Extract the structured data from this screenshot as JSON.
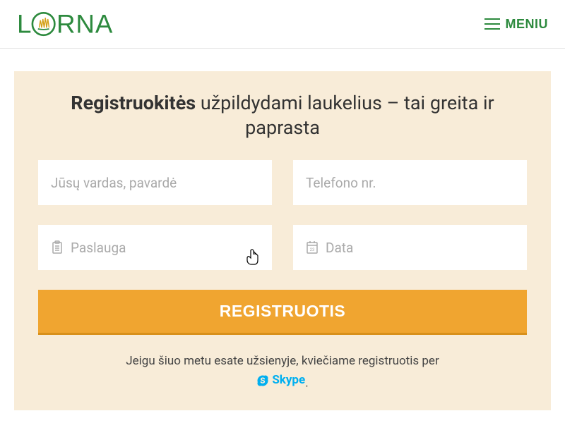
{
  "header": {
    "logo_text": "LORNA",
    "menu_label": "MENIU"
  },
  "form": {
    "heading_bold": "Registruokitės",
    "heading_rest": " užpildydami laukelius – tai greita ir paprasta",
    "name_placeholder": "Jūsų vardas, pavardė",
    "phone_placeholder": "Telefono nr.",
    "service_label": "Paslauga",
    "date_label": "Data",
    "submit_label": "REGISTRUOTIS"
  },
  "note": {
    "text": "Jeigu šiuo metu esate užsienyje, kviečiame registruotis per ",
    "skype_label": "Skype",
    "period": "."
  },
  "colors": {
    "brand_green": "#2d8a3e",
    "card_bg": "#f8ecd8",
    "button_orange": "#f0a530",
    "skype_blue": "#00aff0"
  }
}
